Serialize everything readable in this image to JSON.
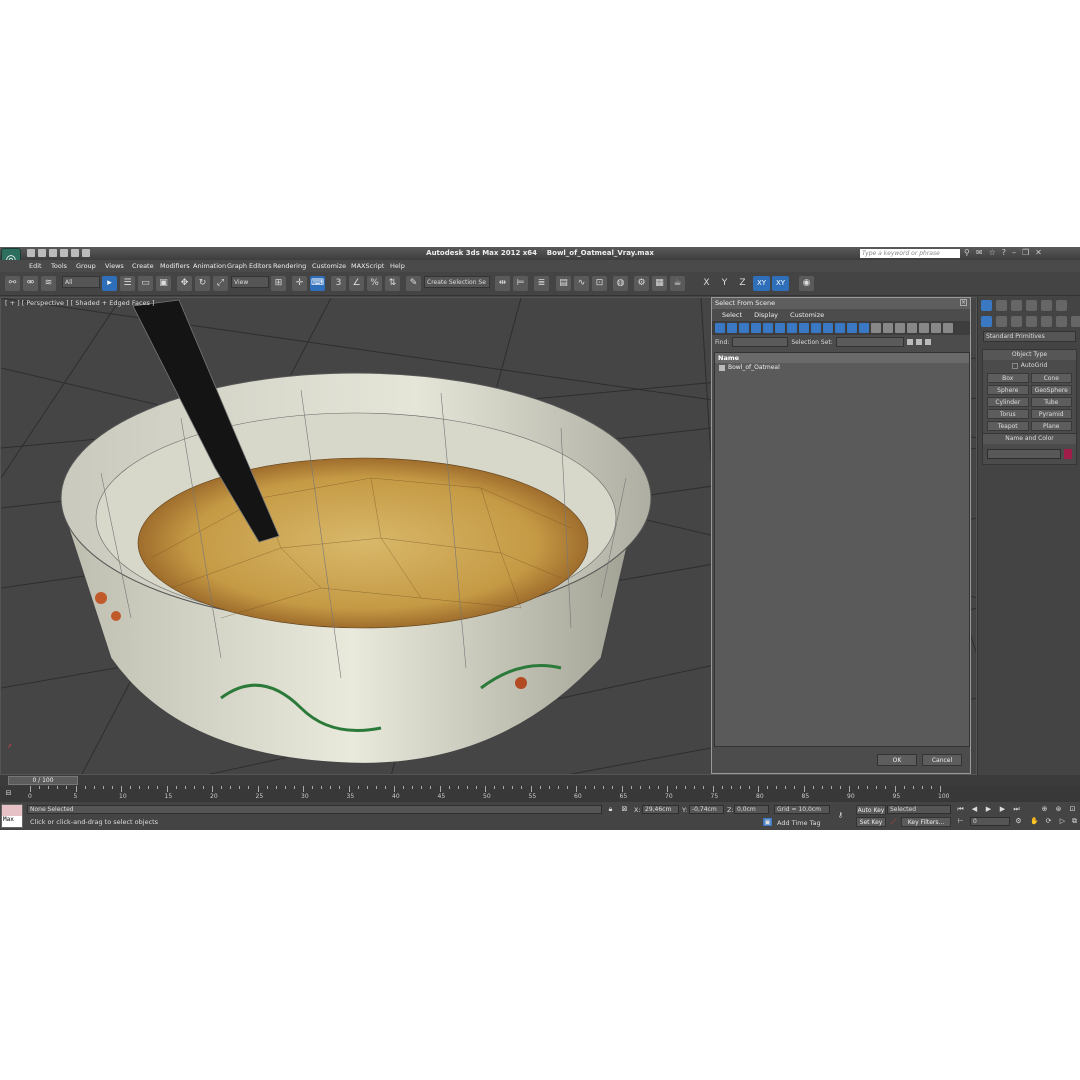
{
  "window": {
    "app_title": "Autodesk 3ds Max  2012 x64",
    "file_name": "Bowl_of_Oatmeal_Vray.max",
    "search_placeholder": "Type a keyword or phrase"
  },
  "menu": [
    "Edit",
    "Tools",
    "Group",
    "Views",
    "Create",
    "Modifiers",
    "Animation",
    "Graph Editors",
    "Rendering",
    "Customize",
    "MAXScript",
    "Help"
  ],
  "toolbar": {
    "selection_filter": "All",
    "reference_coord": "View",
    "named_selection": "Create Selection Se",
    "axis_x": "X",
    "axis_y": "Y",
    "axis_z": "Z",
    "axis_xy": "XY",
    "axis_xy2": "XY",
    "snap_label": "3",
    "percent_snap": "%"
  },
  "viewport": {
    "label": "[ + ] [ Perspective ] [ Shaded + Edged Faces ]"
  },
  "command_panel": {
    "category": "Standard Primitives",
    "object_type_title": "Object Type",
    "autogrid_label": "AutoGrid",
    "primitives": [
      "Box",
      "Cone",
      "Sphere",
      "GeoSphere",
      "Cylinder",
      "Tube",
      "Torus",
      "Pyramid",
      "Teapot",
      "Plane"
    ],
    "name_color_title": "Name and Color",
    "object_color": "#a01d4a"
  },
  "select_dialog": {
    "title": "Select From Scene",
    "menu": [
      "Select",
      "Display",
      "Customize"
    ],
    "find_label": "Find:",
    "selection_set_label": "Selection Set:",
    "column_name": "Name",
    "objects": [
      "Bowl_of_Oatmeal"
    ],
    "ok_label": "OK",
    "cancel_label": "Cancel"
  },
  "timeline": {
    "slider_label": "0 / 100",
    "ticks": [
      "0",
      "5",
      "10",
      "15",
      "20",
      "25",
      "30",
      "35",
      "40",
      "45",
      "50",
      "55",
      "60",
      "65",
      "70",
      "75",
      "80",
      "85",
      "90",
      "95",
      "100"
    ]
  },
  "status": {
    "maxscript_label": "Max",
    "selection_status": "None Selected",
    "prompt": "Click or click-and-drag to select objects",
    "x_label": "X:",
    "x_value": "29,46cm",
    "y_label": "Y:",
    "y_value": "-0,74cm",
    "z_label": "Z:",
    "z_value": "0,0cm",
    "grid": "Grid = 10,0cm",
    "add_time_tag": "Add Time Tag",
    "auto_key": "Auto Key",
    "auto_key_mode": "Selected",
    "set_key": "Set Key",
    "key_filters": "Key Filters...",
    "frame_value": "0"
  }
}
